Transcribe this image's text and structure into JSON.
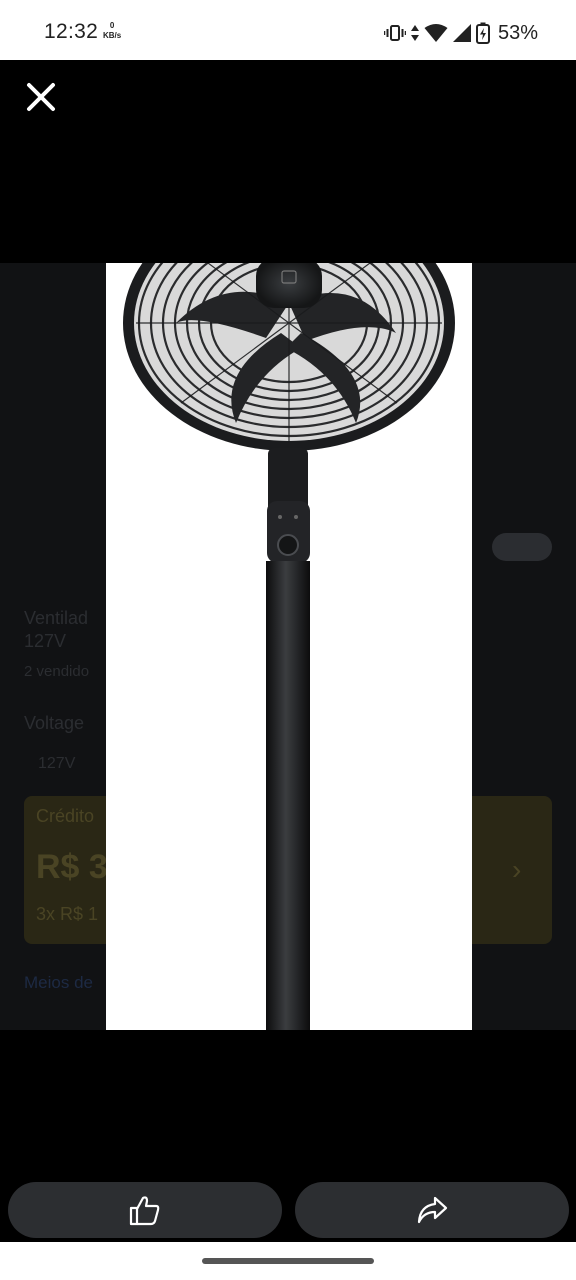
{
  "status_bar": {
    "time": "12:32",
    "net_speed_value": "0",
    "net_speed_unit": "KB/s",
    "battery": "53%",
    "icons": [
      "vibrate-icon",
      "data-arrows-icon",
      "wifi-icon",
      "signal-icon",
      "battery-charging-icon"
    ]
  },
  "viewer": {
    "close_icon": "close-icon",
    "image": {
      "subject": "pedestal fan (black)"
    },
    "actions": {
      "like_icon": "thumbs-up-icon",
      "share_icon": "share-icon"
    }
  },
  "underlay": {
    "title_partial": "Ventilad",
    "title_line2": "127V",
    "sold": "2 vendido",
    "voltage_label": "Voltage",
    "voltage_value": "127V",
    "credit_label": "Crédito",
    "price_partial": "R$ 3",
    "installments_partial": "3x R$ 1",
    "payment_link_partial": "Meios de"
  }
}
